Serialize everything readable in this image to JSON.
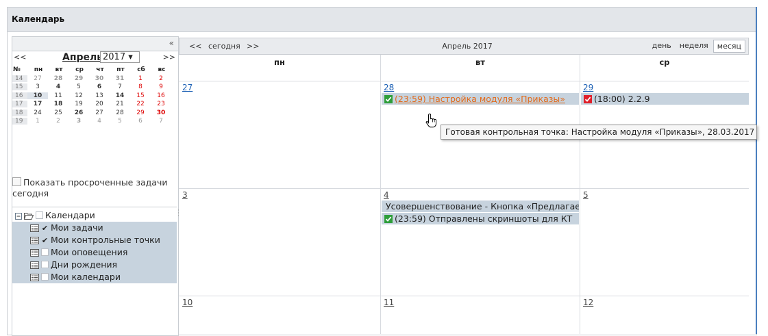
{
  "panel": {
    "title": "Календарь"
  },
  "mini_calendar": {
    "collapse_glyph": "«",
    "prev": "<<",
    "next": ">>",
    "month": "Апрель",
    "year": "2017 ▾",
    "week_header": [
      "№",
      "пн",
      "вт",
      "ср",
      "чт",
      "пт",
      "сб",
      "вс"
    ],
    "weeks": [
      {
        "wk": "14",
        "days": [
          "27",
          "28",
          "29",
          "30",
          "31",
          "1",
          "2"
        ]
      },
      {
        "wk": "15",
        "days": [
          "3",
          "4",
          "5",
          "6",
          "7",
          "8",
          "9"
        ]
      },
      {
        "wk": "16",
        "days": [
          "10",
          "11",
          "12",
          "13",
          "14",
          "15",
          "16"
        ]
      },
      {
        "wk": "17",
        "days": [
          "17",
          "18",
          "19",
          "20",
          "21",
          "22",
          "23"
        ]
      },
      {
        "wk": "18",
        "days": [
          "24",
          "25",
          "26",
          "27",
          "28",
          "29",
          "30"
        ]
      },
      {
        "wk": "19",
        "days": [
          "1",
          "2",
          "3",
          "4",
          "5",
          "6",
          "7"
        ]
      }
    ]
  },
  "overdue": {
    "label": "Показать просроченные задачи сегодня"
  },
  "tree": {
    "root": "Календари",
    "items": [
      {
        "label": "Мои задачи",
        "checked": "✔"
      },
      {
        "label": "Мои контрольные точки",
        "checked": "✔"
      },
      {
        "label": "Мои оповещения",
        "checked": ""
      },
      {
        "label": "Дни рождения",
        "checked": ""
      },
      {
        "label": "Мои календари",
        "checked": ""
      }
    ]
  },
  "toolbar": {
    "prev": "<<",
    "today": "сегодня",
    "next": ">>",
    "title": "Апрель 2017",
    "views": [
      "день",
      "неделя",
      "месяц"
    ],
    "active_view": "месяц"
  },
  "columns": [
    "пн",
    "вт",
    "ср"
  ],
  "weeks": [
    {
      "days": [
        "27",
        "28",
        "29"
      ]
    },
    {
      "days": [
        "3",
        "4",
        "5"
      ]
    },
    {
      "days": [
        "10",
        "11",
        "12"
      ]
    }
  ],
  "events": {
    "e1": "(23:59) Настройка модуля «Приказы»",
    "e2": "(18:00) 2.2.9",
    "e3": "Усовершенствование - Кнопка «Предлагае",
    "e4": "(23:59) Отправлены скриншоты для КТ"
  },
  "tooltip": "Готовая контрольная точка: Настройка модуля «Приказы», 28.03.2017",
  "colors": {
    "accent": "#1a5fb4",
    "event_bg": "#c7d3de",
    "link_orange": "#e26a1a",
    "check_green": "#2e9e3a",
    "check_red": "#e0202a"
  }
}
